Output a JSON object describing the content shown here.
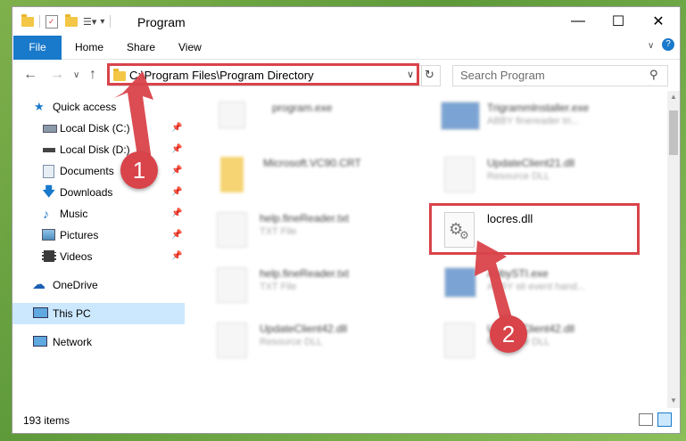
{
  "window": {
    "title": "Program"
  },
  "ribbon": {
    "tabs": [
      "File",
      "Home",
      "Share",
      "View"
    ]
  },
  "address": {
    "path": "C:\\Program Files\\Program Directory"
  },
  "search": {
    "placeholder": "Search Program"
  },
  "nav": {
    "items": [
      {
        "label": "Quick access",
        "icon": "star-icon"
      },
      {
        "label": "Local Disk (C:)",
        "icon": "drive-icon",
        "pinned": true
      },
      {
        "label": "Local Disk (D:)",
        "icon": "drive-icon",
        "pinned": true
      },
      {
        "label": "Documents",
        "icon": "documents-icon",
        "pinned": true
      },
      {
        "label": "Downloads",
        "icon": "download-icon",
        "pinned": true
      },
      {
        "label": "Music",
        "icon": "music-icon",
        "pinned": true
      },
      {
        "label": "Pictures",
        "icon": "pictures-icon",
        "pinned": true
      },
      {
        "label": "Videos",
        "icon": "videos-icon",
        "pinned": true
      },
      {
        "label": "OneDrive",
        "icon": "cloud-icon"
      },
      {
        "label": "This PC",
        "icon": "computer-icon",
        "selected": true
      },
      {
        "label": "Network",
        "icon": "network-icon"
      }
    ]
  },
  "files": [
    {
      "name": "program.exe",
      "desc": ""
    },
    {
      "name": "Trigrammlnstaller.exe",
      "desc": "ABBY finereader tri..."
    },
    {
      "name": "Microsoft.VC90.CRT",
      "desc": ""
    },
    {
      "name": "UpdateClient21.dll",
      "desc": "Resource DLL"
    },
    {
      "name": "help.fineReader.txt",
      "desc": "TXT File"
    },
    {
      "name": "locres.dll",
      "desc": ""
    },
    {
      "name": "help.fineReader.txt",
      "desc": "TXT File"
    },
    {
      "name": "AbbySTI.exe",
      "desc": "ABBY sti event hand..."
    },
    {
      "name": "UpdateClient42.dll",
      "desc": "Resource DLL"
    },
    {
      "name": "UpdateClient42.dll",
      "desc": "Resource DLL"
    }
  ],
  "status": {
    "count": "193 items"
  },
  "callouts": {
    "one": "1",
    "two": "2"
  },
  "colors": {
    "accent": "#1979ca",
    "highlight": "#d9434a",
    "selected": "#cce8ff"
  }
}
